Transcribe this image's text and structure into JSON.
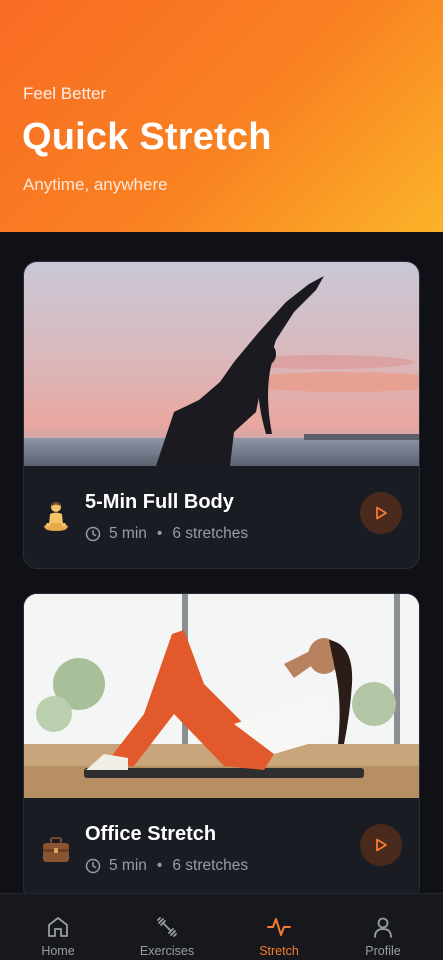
{
  "header": {
    "eyebrow": "Feel Better",
    "title": "Quick Stretch",
    "subtitle": "Anytime, anywhere"
  },
  "routines": [
    {
      "name": "5-Min Full Body",
      "duration": "5 min",
      "separator": "•",
      "stretches": "6 stretches",
      "emoji": "meditating-person"
    },
    {
      "name": "Office Stretch",
      "duration": "5 min",
      "separator": "•",
      "stretches": "6 stretches",
      "emoji": "briefcase"
    }
  ],
  "tabs": [
    {
      "label": "Home",
      "icon": "home-icon",
      "active": false
    },
    {
      "label": "Exercises",
      "icon": "dumbbell-icon",
      "active": false
    },
    {
      "label": "Stretch",
      "icon": "pulse-icon",
      "active": true
    },
    {
      "label": "Profile",
      "icon": "user-icon",
      "active": false
    }
  ],
  "colors": {
    "accent": "#f47a2e",
    "header_gradient_start": "#f86b24",
    "header_gradient_end": "#fbb329",
    "background": "#0f1116",
    "card": "#1a1c23"
  }
}
